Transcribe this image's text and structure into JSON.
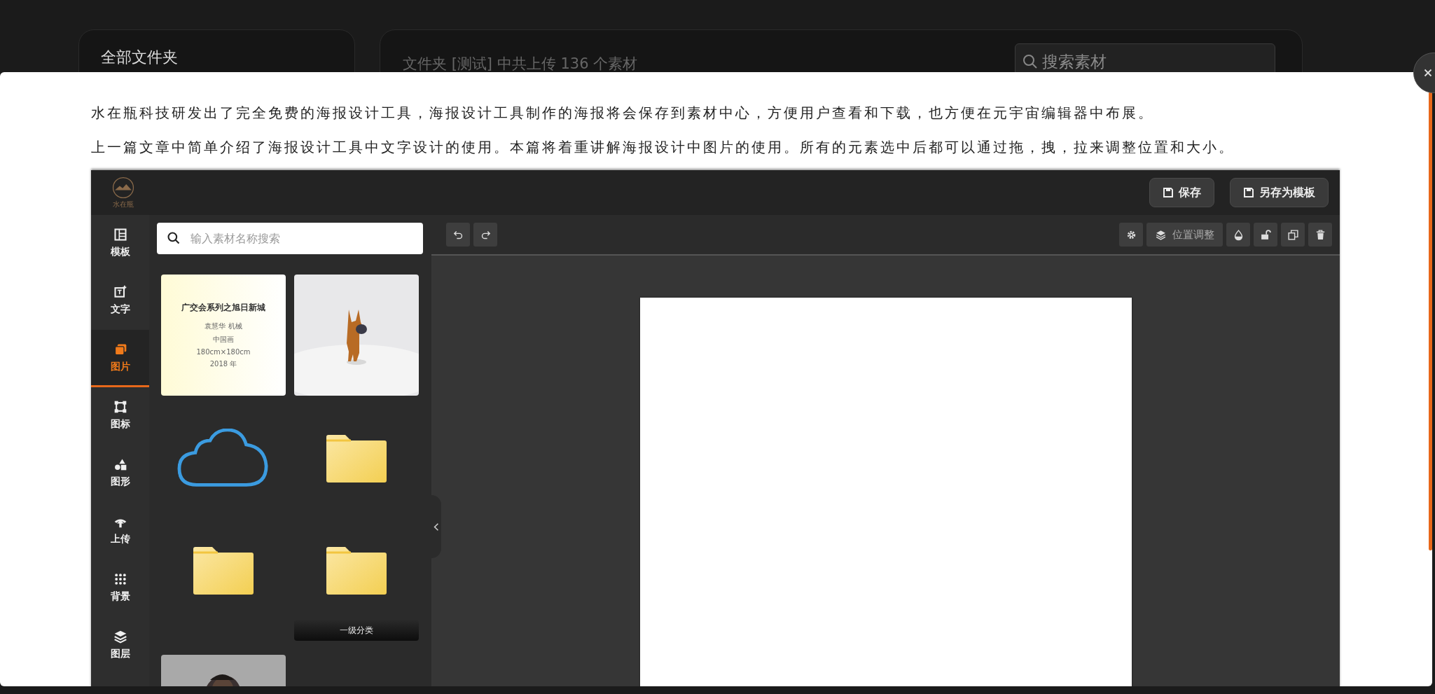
{
  "background": {
    "sidebar_title": "全部文件夹",
    "summary": "文件夹 [测试] 中共上传 136 个素材",
    "search": {
      "placeholder": "搜索素材"
    }
  },
  "article": {
    "paragraphs": [
      "水在瓶科技研发出了完全免费的海报设计工具，海报设计工具制作的海报将会保存到素材中心，方便用户查看和下载，也方便在元宇宙编辑器中布展。",
      "上一篇文章中简单介绍了海报设计工具中文字设计的使用。本篇将着重讲解海报设计中图片的使用。所有的元素选中后都可以通过拖，拽，拉来调整位置和大小。"
    ],
    "screenshot": {
      "logo": "水在瓶",
      "header_buttons": [
        {
          "label": "保存"
        },
        {
          "label": "另存为模板"
        }
      ],
      "nav": [
        {
          "kind": "template",
          "label": "模板",
          "selected": false
        },
        {
          "kind": "text",
          "label": "文字",
          "selected": false
        },
        {
          "label": "图片",
          "selected": true
        },
        {
          "kind": "icon",
          "label": "图标",
          "selected": false
        },
        {
          "kind": "shape",
          "label": "图形",
          "selected": false
        },
        {
          "kind": "upload",
          "label": "上传",
          "selected": false
        },
        {
          "kind": "background",
          "label": "背景",
          "selected": false
        },
        {
          "kind": "layers",
          "label": "图层",
          "selected": false
        }
      ],
      "search": {
        "placeholder": "输入素材名称搜索"
      },
      "assets": [
        {
          "kind": "poster",
          "title": "广交会系列之旭日新城",
          "lines": [
            "袁慧华 机械",
            "中国画",
            "180cm×180cm",
            "2018 年"
          ]
        },
        {
          "kind": "picture"
        },
        {
          "kind": "cloud"
        },
        {
          "kind": "folder"
        },
        {
          "kind": "folder"
        },
        {
          "kind": "folder",
          "caption": "一级分类"
        },
        {
          "kind": "picture"
        }
      ],
      "history": [
        {
          "kind": "undo"
        },
        {
          "kind": "redo"
        }
      ],
      "tools": [
        {
          "kind": "gear"
        },
        {
          "kind": "layers",
          "label": "位置调整"
        },
        {
          "kind": "drop"
        },
        {
          "kind": "lock"
        },
        {
          "kind": "copy"
        },
        {
          "kind": "trash"
        }
      ]
    }
  }
}
